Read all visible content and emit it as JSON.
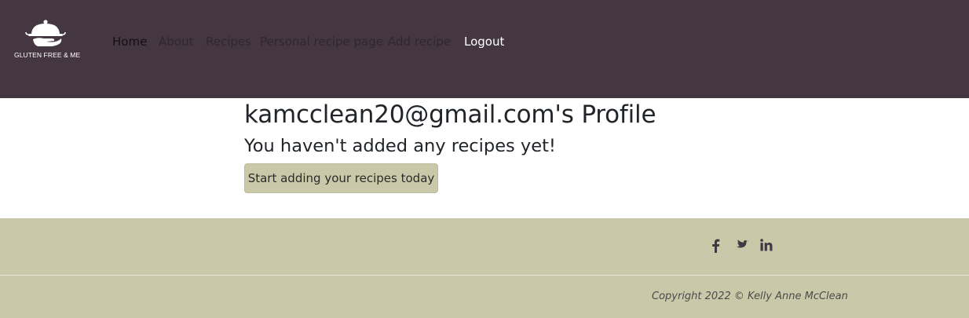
{
  "brand": {
    "name": "GLUTEN FREE & ME",
    "logo_icon": "serving-dish-icon"
  },
  "nav": {
    "items": [
      {
        "label": "Home",
        "active": true
      },
      {
        "label": "About"
      },
      {
        "label": "Recipes"
      },
      {
        "label": "Personal recipe page"
      },
      {
        "label": "Add recipe"
      },
      {
        "label": "Logout"
      }
    ]
  },
  "main": {
    "profile_title": "kamcclean20@gmail.com's Profile",
    "empty_message": "You haven't added any recipes yet!",
    "add_button_label": "Start adding your recipes today"
  },
  "footer": {
    "social_icons": [
      "facebook-icon",
      "twitter-icon",
      "linkedin-icon"
    ],
    "copyright": "Copyright 2022 © Kelly Anne McClean"
  },
  "colors": {
    "navbar_bg": "#443742",
    "accent": "#c9c9a9",
    "text_dark": "#212529"
  }
}
